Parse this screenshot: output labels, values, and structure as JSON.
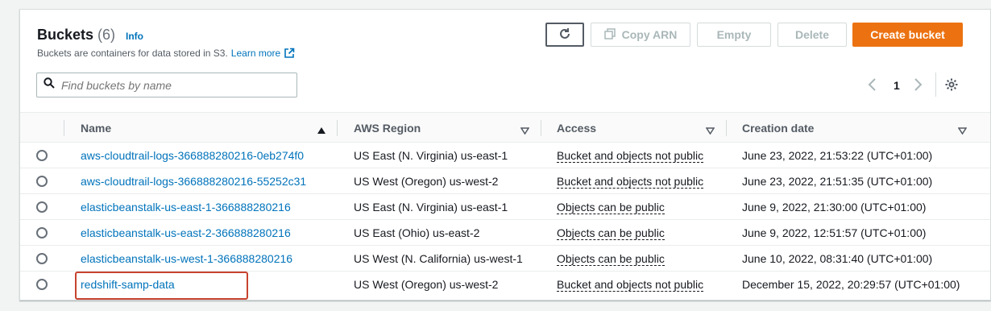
{
  "header": {
    "title": "Buckets",
    "count": "(6)",
    "info_label": "Info",
    "description": "Buckets are containers for data stored in S3.",
    "learn_more": "Learn more"
  },
  "toolbar": {
    "copy_arn_label": "Copy ARN",
    "empty_label": "Empty",
    "delete_label": "Delete",
    "create_label": "Create bucket"
  },
  "search": {
    "placeholder": "Find buckets by name"
  },
  "pagination": {
    "current_page": "1"
  },
  "table": {
    "columns": [
      "Name",
      "AWS Region",
      "Access",
      "Creation date"
    ],
    "rows": [
      {
        "name": "aws-cloudtrail-logs-366888280216-0eb274f0",
        "region": "US East (N. Virginia) us-east-1",
        "access": "Bucket and objects not public",
        "created": "June 23, 2022, 21:53:22 (UTC+01:00)"
      },
      {
        "name": "aws-cloudtrail-logs-366888280216-55252c31",
        "region": "US West (Oregon) us-west-2",
        "access": "Bucket and objects not public",
        "created": "June 23, 2022, 21:51:35 (UTC+01:00)"
      },
      {
        "name": "elasticbeanstalk-us-east-1-366888280216",
        "region": "US East (N. Virginia) us-east-1",
        "access": "Objects can be public",
        "created": "June 9, 2022, 21:30:00 (UTC+01:00)"
      },
      {
        "name": "elasticbeanstalk-us-east-2-366888280216",
        "region": "US East (Ohio) us-east-2",
        "access": "Objects can be public",
        "created": "June 9, 2022, 12:51:57 (UTC+01:00)"
      },
      {
        "name": "elasticbeanstalk-us-west-1-366888280216",
        "region": "US West (N. California) us-west-1",
        "access": "Objects can be public",
        "created": "June 10, 2022, 08:31:40 (UTC+01:00)"
      },
      {
        "name": "redshift-samp-data",
        "region": "US West (Oregon) us-west-2",
        "access": "Bucket and objects not public",
        "created": "December 15, 2022, 20:29:57 (UTC+01:00)"
      }
    ]
  },
  "colors": {
    "link": "#0073bb",
    "primary_button": "#ec7211",
    "highlight_border": "#c7422e"
  }
}
